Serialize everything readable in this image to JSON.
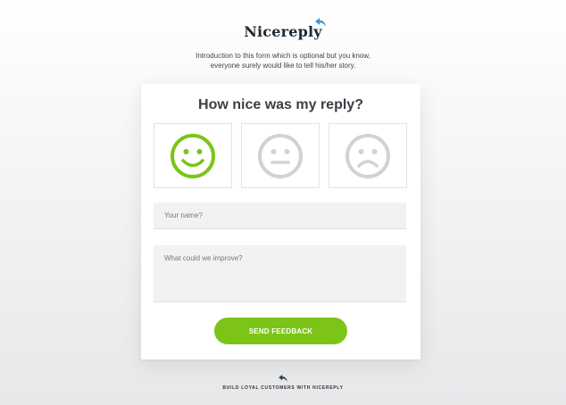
{
  "brand": {
    "name": "Nicereply",
    "accent": "#3a9ad9"
  },
  "intro": {
    "line1": "Introduction to this form which is optional but you know,",
    "line2": "everyone surely would like to tell his/her story."
  },
  "card": {
    "title": "How nice was my reply?",
    "faces": [
      {
        "name": "happy-face-icon",
        "selected": true,
        "color": "#7cc417"
      },
      {
        "name": "neutral-face-icon",
        "selected": false,
        "color": "#d2d2d2"
      },
      {
        "name": "sad-face-icon",
        "selected": false,
        "color": "#d2d2d2"
      }
    ],
    "name_placeholder": "Your name?",
    "improve_placeholder": "What could we improve?",
    "send_label": "SEND FEEDBACK",
    "button_color": "#7cc417"
  },
  "footer": {
    "text": "BUILD LOYAL CUSTOMERS WITH NICEREPLY",
    "icon": "reply-arrow-icon"
  }
}
